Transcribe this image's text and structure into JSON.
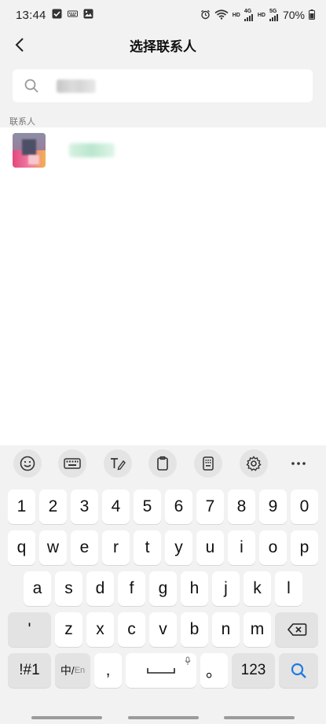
{
  "status_bar": {
    "time": "13:44",
    "hd1": "HD",
    "net1": "4G",
    "hd2": "HD",
    "net2": "5G",
    "battery": "70%"
  },
  "header": {
    "title": "选择联系人"
  },
  "search": {
    "placeholder": ""
  },
  "section_label": "联系人",
  "contacts": [
    {
      "name": ""
    }
  ],
  "keyboard": {
    "number_row": [
      "1",
      "2",
      "3",
      "4",
      "5",
      "6",
      "7",
      "8",
      "9",
      "0"
    ],
    "row1": [
      "q",
      "w",
      "e",
      "r",
      "t",
      "y",
      "u",
      "i",
      "o",
      "p"
    ],
    "row2": [
      "a",
      "s",
      "d",
      "f",
      "g",
      "h",
      "j",
      "k",
      "l"
    ],
    "row3": [
      "'",
      "z",
      "x",
      "c",
      "v",
      "b",
      "n",
      "m"
    ],
    "symbols_key": "!#1",
    "lang_key": "中/",
    "lang_key_sub": "En",
    "comma_key": ",",
    "period_key": "。",
    "num_key": "123"
  },
  "colors": {
    "accent": "#1f7ae0",
    "background": "#f2f2f2"
  }
}
